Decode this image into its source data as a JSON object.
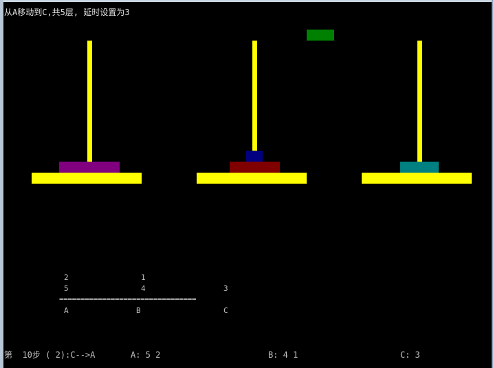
{
  "header": {
    "title": "从A移动到C,共5层, 延时设置为3"
  },
  "colors": {
    "rod": "#ffff00",
    "base": "#ffff00",
    "disk_green": "#008000",
    "disk_purple": "#800080",
    "disk_navy": "#000080",
    "disk_maroon": "#800000",
    "disk_teal": "#008080"
  },
  "towers": [
    {
      "name": "A",
      "disks": [
        5
      ]
    },
    {
      "name": "B",
      "disks": [
        4,
        1
      ]
    },
    {
      "name": "C",
      "disks": [
        3
      ]
    }
  ],
  "moving_disk": 2,
  "stack_text": {
    "row1": [
      "2",
      "1",
      ""
    ],
    "row2": [
      "5",
      "4",
      "3"
    ],
    "separator": "================================",
    "labels": [
      "A",
      "B",
      "C"
    ]
  },
  "status": {
    "step": "第  10步 ( 2):C-->A",
    "a": "A: 5 2",
    "b": "B: 4 1",
    "c": "C: 3"
  }
}
